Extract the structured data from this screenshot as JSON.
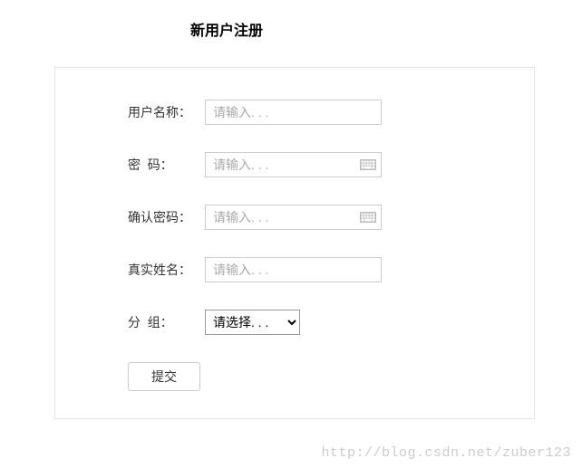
{
  "title": "新用户注册",
  "fields": {
    "username": {
      "label": "用户名称：",
      "placeholder": "请输入. . ."
    },
    "password": {
      "label": "密  码：",
      "placeholder": "请输入. . ."
    },
    "confirm": {
      "label": "确认密码：",
      "placeholder": "请输入. . ."
    },
    "realname": {
      "label": "真实姓名：",
      "placeholder": "请输入. . ."
    },
    "group": {
      "label": "分  组：",
      "selected": "请选择. . ."
    }
  },
  "submit_label": "提交",
  "watermark": "http://blog.csdn.net/zuber123"
}
